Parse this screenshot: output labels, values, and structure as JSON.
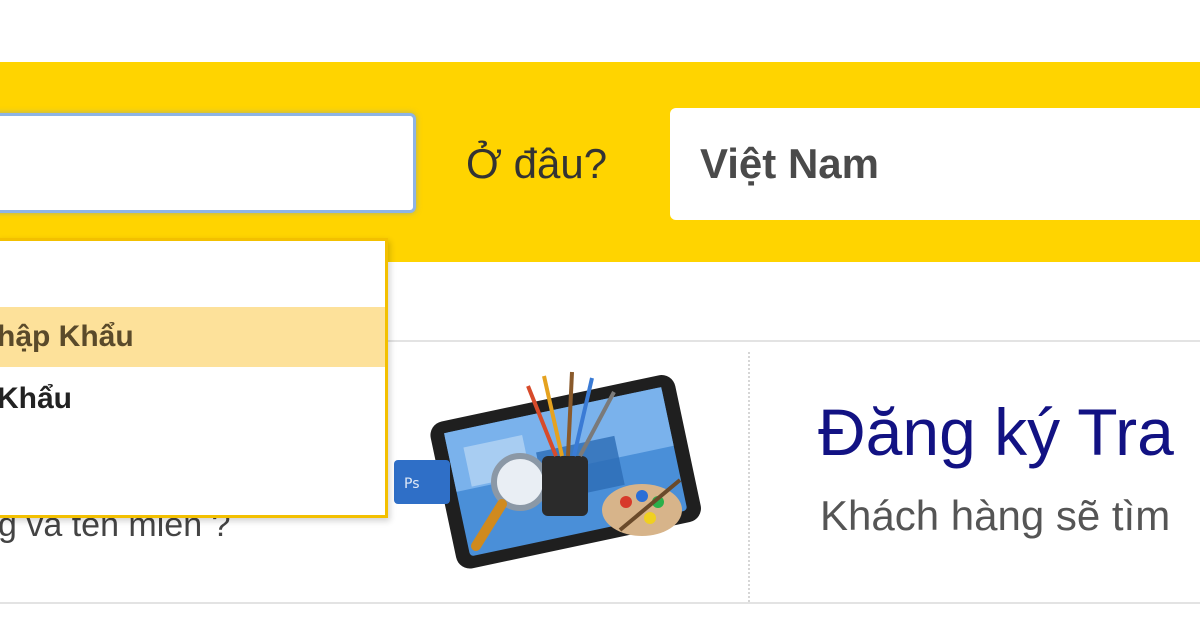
{
  "search": {
    "what_value": "",
    "where_label": "Ở đâu?",
    "where_value": "Việt Nam"
  },
  "suggestions": [
    {
      "label": "",
      "highlighted": false
    },
    {
      "label": "hập Khẩu",
      "highlighted": true
    },
    {
      "label": "Khẩu",
      "highlighted": false
    },
    {
      "label": "",
      "highlighted": false
    }
  ],
  "promo_left": {
    "text": "g và tên miền ?"
  },
  "promo_right": {
    "title": "Đăng ký Tra",
    "subtitle": "Khách hàng sẽ tìm"
  },
  "colors": {
    "accent_yellow": "#ffd400",
    "highlight": "#fde19a",
    "title_blue": "#121283"
  },
  "icons": {
    "promo_illustration": "tablet-with-paint-brushes-icon"
  }
}
